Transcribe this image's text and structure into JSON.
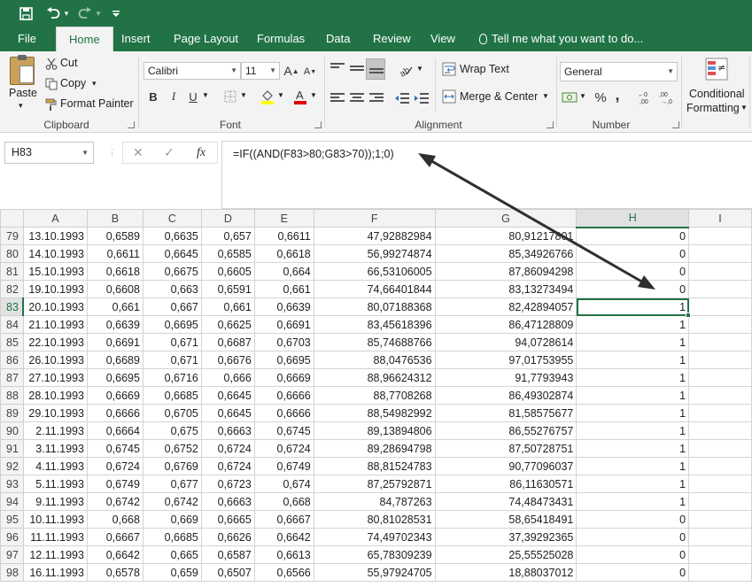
{
  "quick_access": {
    "save_icon": "save-icon",
    "undo_icon": "undo-icon",
    "redo_icon": "redo-icon",
    "customize_icon": "customize-icon"
  },
  "tabs": [
    "File",
    "Home",
    "Insert",
    "Page Layout",
    "Formulas",
    "Data",
    "Review",
    "View"
  ],
  "tell_me": "Tell me what you want to do...",
  "ribbon": {
    "clipboard": {
      "paste": "Paste",
      "cut": "Cut",
      "copy": "Copy",
      "format_painter": "Format Painter",
      "label": "Clipboard"
    },
    "font": {
      "family": "Calibri",
      "size": "11",
      "bold": "B",
      "italic": "I",
      "underline": "U",
      "label": "Font"
    },
    "alignment": {
      "wrap_text": "Wrap Text",
      "merge_center": "Merge & Center",
      "label": "Alignment"
    },
    "number": {
      "format": "General",
      "percent": "%",
      "comma": ",",
      "label": "Number"
    },
    "styles": {
      "conditional_formatting_1": "Conditional",
      "conditional_formatting_2": "Formatting"
    }
  },
  "formula_bar": {
    "name_box": "H83",
    "cancel": "✕",
    "enter": "✓",
    "fx": "fx",
    "formula": "=IF((AND(F83>80;G83>70));1;0)"
  },
  "columns": [
    "A",
    "B",
    "C",
    "D",
    "E",
    "F",
    "G",
    "H",
    "I"
  ],
  "selected": {
    "column": "H",
    "row": "83"
  },
  "rows": [
    [
      "79",
      "13.10.1993",
      "0,6589",
      "0,6635",
      "0,657",
      "0,6611",
      "47,92882984",
      "80,91217801",
      "0"
    ],
    [
      "80",
      "14.10.1993",
      "0,6611",
      "0,6645",
      "0,6585",
      "0,6618",
      "56,99274874",
      "85,34926766",
      "0"
    ],
    [
      "81",
      "15.10.1993",
      "0,6618",
      "0,6675",
      "0,6605",
      "0,664",
      "66,53106005",
      "87,86094298",
      "0"
    ],
    [
      "82",
      "19.10.1993",
      "0,6608",
      "0,663",
      "0,6591",
      "0,661",
      "74,66401844",
      "83,13273494",
      "0"
    ],
    [
      "83",
      "20.10.1993",
      "0,661",
      "0,667",
      "0,661",
      "0,6639",
      "80,07188368",
      "82,42894057",
      "1"
    ],
    [
      "84",
      "21.10.1993",
      "0,6639",
      "0,6695",
      "0,6625",
      "0,6691",
      "83,45618396",
      "86,47128809",
      "1"
    ],
    [
      "85",
      "22.10.1993",
      "0,6691",
      "0,671",
      "0,6687",
      "0,6703",
      "85,74688766",
      "94,0728614",
      "1"
    ],
    [
      "86",
      "26.10.1993",
      "0,6689",
      "0,671",
      "0,6676",
      "0,6695",
      "88,0476536",
      "97,01753955",
      "1"
    ],
    [
      "87",
      "27.10.1993",
      "0,6695",
      "0,6716",
      "0,666",
      "0,6669",
      "88,96624312",
      "91,7793943",
      "1"
    ],
    [
      "88",
      "28.10.1993",
      "0,6669",
      "0,6685",
      "0,6645",
      "0,6666",
      "88,7708268",
      "86,49302874",
      "1"
    ],
    [
      "89",
      "29.10.1993",
      "0,6666",
      "0,6705",
      "0,6645",
      "0,6666",
      "88,54982992",
      "81,58575677",
      "1"
    ],
    [
      "90",
      "2.11.1993",
      "0,6664",
      "0,675",
      "0,6663",
      "0,6745",
      "89,13894806",
      "86,55276757",
      "1"
    ],
    [
      "91",
      "3.11.1993",
      "0,6745",
      "0,6752",
      "0,6724",
      "0,6724",
      "89,28694798",
      "87,50728751",
      "1"
    ],
    [
      "92",
      "4.11.1993",
      "0,6724",
      "0,6769",
      "0,6724",
      "0,6749",
      "88,81524783",
      "90,77096037",
      "1"
    ],
    [
      "93",
      "5.11.1993",
      "0,6749",
      "0,677",
      "0,6723",
      "0,674",
      "87,25792871",
      "86,11630571",
      "1"
    ],
    [
      "94",
      "9.11.1993",
      "0,6742",
      "0,6742",
      "0,6663",
      "0,668",
      "84,787263",
      "74,48473431",
      "1"
    ],
    [
      "95",
      "10.11.1993",
      "0,668",
      "0,669",
      "0,6665",
      "0,6667",
      "80,81028531",
      "58,65418491",
      "0"
    ],
    [
      "96",
      "11.11.1993",
      "0,6667",
      "0,6685",
      "0,6626",
      "0,6642",
      "74,49702343",
      "37,39292365",
      "0"
    ],
    [
      "97",
      "12.11.1993",
      "0,6642",
      "0,665",
      "0,6587",
      "0,6613",
      "65,78309239",
      "25,55525028",
      "0"
    ],
    [
      "98",
      "16.11.1993",
      "0,6578",
      "0,659",
      "0,6507",
      "0,6566",
      "55,97924705",
      "18,88037012",
      "0"
    ]
  ],
  "colors": {
    "excel_green": "#217346",
    "ribbon_bg": "#f3f3f3",
    "grid_line": "#d4d4d4"
  }
}
